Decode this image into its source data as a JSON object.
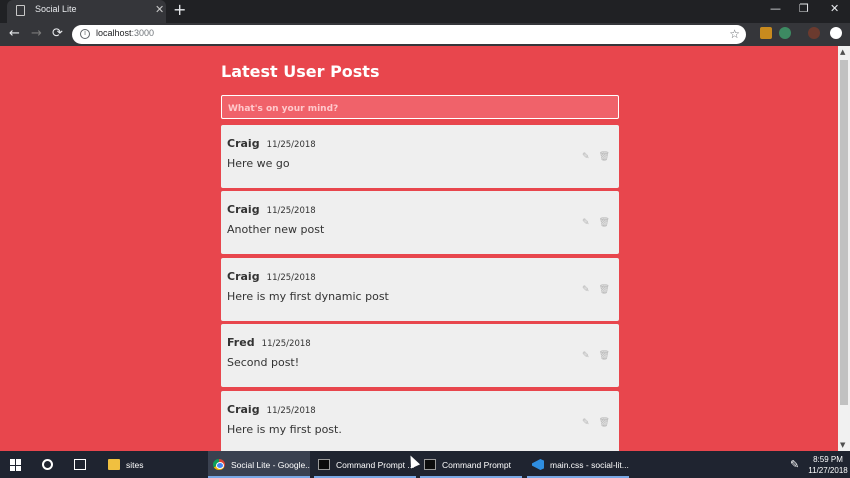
{
  "browser": {
    "tab_title": "Social Lite",
    "tab_close_glyph": "✕",
    "new_tab_glyph": "+",
    "window_controls": [
      "—",
      "❐",
      "✕"
    ],
    "back_glyph": "←",
    "forward_glyph": "→",
    "reload_glyph": "⟳",
    "url_host": "localhost",
    "url_port": ":3000",
    "star_glyph": "☆",
    "info_glyph": "i"
  },
  "page": {
    "heading": "Latest User Posts",
    "composer_placeholder": "What's on your mind?",
    "edit_glyph": "✎",
    "delete_glyph": "🗑",
    "posts": [
      {
        "author": "Craig",
        "date": "11/25/2018",
        "body": "Here we go"
      },
      {
        "author": "Craig",
        "date": "11/25/2018",
        "body": "Another new post"
      },
      {
        "author": "Craig",
        "date": "11/25/2018",
        "body": "Here is my first dynamic post"
      },
      {
        "author": "Fred",
        "date": "11/25/2018",
        "body": "Second post!"
      },
      {
        "author": "Craig",
        "date": "11/25/2018",
        "body": "Here is my first post."
      }
    ]
  },
  "scrollbar": {
    "up_glyph": "▲",
    "down_glyph": "▼"
  },
  "taskbar": {
    "apps": [
      {
        "label": "sites",
        "icon": "folder-icon"
      },
      {
        "label": "Social Lite - Google...",
        "icon": "chrome-icon"
      },
      {
        "label": "Command Prompt ...",
        "icon": "cmd-icon"
      },
      {
        "label": "Command Prompt",
        "icon": "cmd-icon"
      },
      {
        "label": "main.css - social-lit...",
        "icon": "vscode-icon"
      }
    ],
    "pen_glyph": "✎",
    "time": "8:59 PM",
    "date": "11/27/2018"
  },
  "colors": {
    "page_background": "#e8464d",
    "card_background": "#efefef",
    "composer_background": "#f0626a",
    "taskbar": "#1f2430"
  }
}
